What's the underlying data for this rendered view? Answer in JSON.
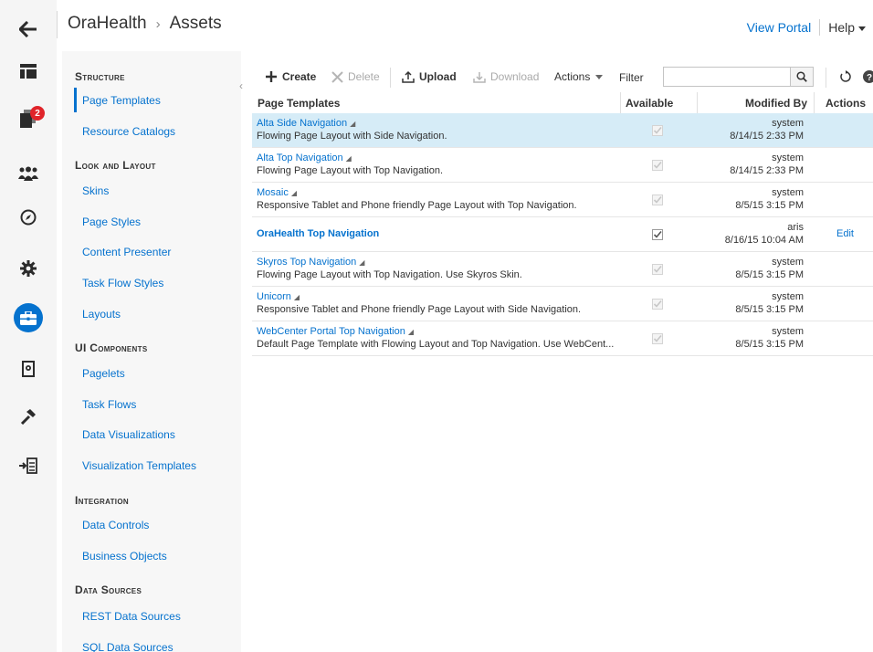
{
  "header": {
    "breadcrumb_root": "OraHealth",
    "breadcrumb_sep": "›",
    "breadcrumb_current": "Assets",
    "view_portal": "View Portal",
    "help": "Help"
  },
  "rail": {
    "notification_count": "2",
    "icons": [
      "back-arrow-icon",
      "layout-icon",
      "pages-icon",
      "people-icon",
      "compass-icon",
      "gear-icon",
      "toolbox-icon",
      "device-settings-icon",
      "hammer-icon",
      "import-icon"
    ],
    "active": "toolbox-icon"
  },
  "categories": {
    "sections": [
      {
        "title": "Structure",
        "items": [
          "Page Templates",
          "Resource Catalogs"
        ]
      },
      {
        "title": "Look and Layout",
        "items": [
          "Skins",
          "Page Styles",
          "Content Presenter",
          "Task Flow Styles",
          "Layouts"
        ]
      },
      {
        "title": "UI Components",
        "items": [
          "Pagelets",
          "Task Flows",
          "Data Visualizations",
          "Visualization Templates"
        ]
      },
      {
        "title": "Integration",
        "items": [
          "Data Controls",
          "Business Objects"
        ]
      },
      {
        "title": "Data Sources",
        "items": [
          "REST Data Sources",
          "SQL Data Sources"
        ]
      }
    ],
    "selected": "Page Templates"
  },
  "toolbar": {
    "create": "Create",
    "delete": "Delete",
    "upload": "Upload",
    "download": "Download",
    "actions": "Actions",
    "filter_label": "Filter",
    "filter_value": ""
  },
  "table": {
    "columns": [
      "Page Templates",
      "Available",
      "Modified By",
      "Actions"
    ],
    "rows": [
      {
        "name": "Alta Side Navigation",
        "desc": "Flowing Page Layout with Side Navigation.",
        "user": "system",
        "date": "8/14/15 2:33 PM",
        "action": "",
        "selected": true,
        "seeded": true,
        "available": true
      },
      {
        "name": "Alta Top Navigation",
        "desc": "Flowing Page Layout with Top Navigation.",
        "user": "system",
        "date": "8/14/15 2:33 PM",
        "action": "",
        "selected": false,
        "seeded": true,
        "available": true
      },
      {
        "name": "Mosaic",
        "desc": "Responsive Tablet and Phone friendly Page Layout with Top Navigation.",
        "user": "system",
        "date": "8/5/15 3:15 PM",
        "action": "",
        "selected": false,
        "seeded": true,
        "available": true
      },
      {
        "name": "OraHealth Top Navigation",
        "desc": "",
        "user": "aris",
        "date": "8/16/15 10:04 AM",
        "action": "Edit",
        "selected": false,
        "seeded": false,
        "available": true
      },
      {
        "name": "Skyros Top Navigation",
        "desc": "Flowing Page Layout with Top Navigation. Use Skyros Skin.",
        "user": "system",
        "date": "8/5/15 3:15 PM",
        "action": "",
        "selected": false,
        "seeded": true,
        "available": true
      },
      {
        "name": "Unicorn",
        "desc": "Responsive Tablet and Phone friendly Page Layout with Side Navigation.",
        "user": "system",
        "date": "8/5/15 3:15 PM",
        "action": "",
        "selected": false,
        "seeded": true,
        "available": true
      },
      {
        "name": "WebCenter Portal Top Navigation",
        "desc": "Default Page Template with Flowing Layout and Top Navigation. Use WebCent...",
        "user": "system",
        "date": "8/5/15 3:15 PM",
        "action": "",
        "selected": false,
        "seeded": true,
        "available": true
      }
    ]
  },
  "colors": {
    "accent": "#0572ce",
    "selected_row": "#d6ecf7",
    "badge": "#e0242a"
  }
}
